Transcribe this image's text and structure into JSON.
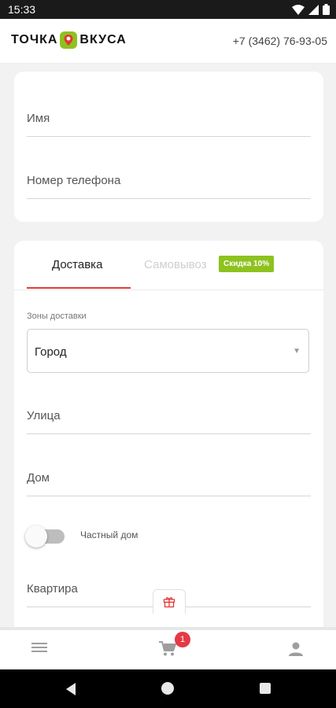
{
  "status_bar": {
    "time": "15:33"
  },
  "header": {
    "logo_left": "ТОЧКА",
    "logo_right": "ВКУСА",
    "phone": "+7 (3462) 76-93-05"
  },
  "contact": {
    "name_label": "Имя",
    "phone_label": "Номер телефона"
  },
  "delivery": {
    "tabs": [
      {
        "label": "Доставка",
        "active": true
      },
      {
        "label": "Самовывоз",
        "active": false
      }
    ],
    "discount_badge": "Скидка 10%",
    "zone_label": "Зоны доставки",
    "zone_value": "Город",
    "street_label": "Улица",
    "house_label": "Дом",
    "private_house_label": "Частный дом",
    "apartment_label": "Квартира"
  },
  "bottom_nav": {
    "cart_count": "1"
  },
  "colors": {
    "accent": "#e53935",
    "discount": "#8dc21f",
    "logo_pin": "#8dc21f"
  }
}
